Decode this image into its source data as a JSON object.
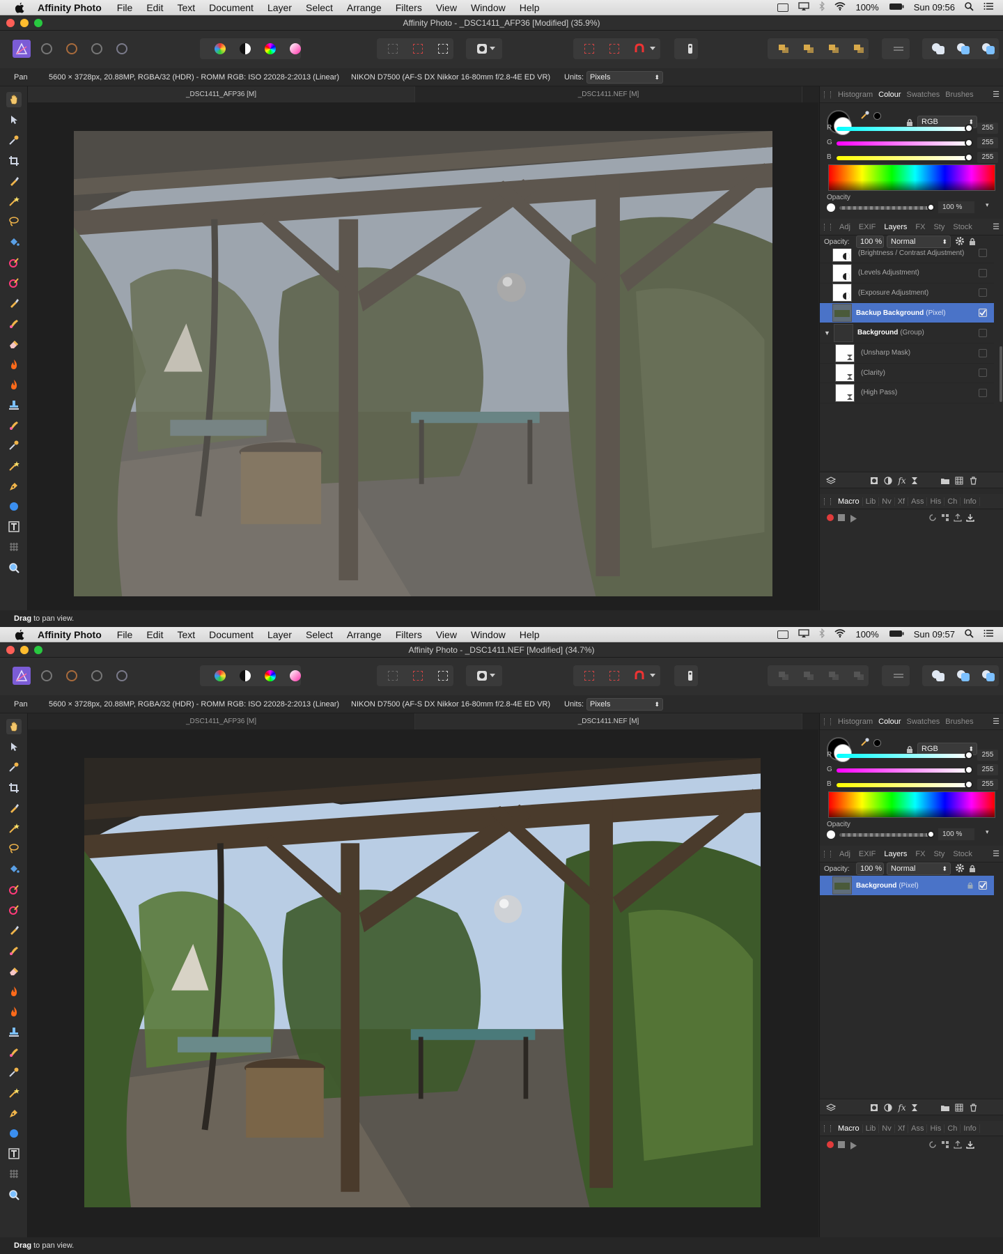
{
  "windows": [
    {
      "menubar": {
        "app_name": "Affinity Photo",
        "items": [
          "File",
          "Edit",
          "Text",
          "Document",
          "Layer",
          "Select",
          "Arrange",
          "Filters",
          "View",
          "Window",
          "Help"
        ],
        "battery": "100%",
        "clock": "Sun 09:56"
      },
      "title": "Affinity Photo - _DSC1411_AFP36 [Modified] (35.9%)",
      "context_bar": {
        "tool": "Pan",
        "doc_info": "5600 × 3728px, 20.88MP, RGBA/32 (HDR) - ROMM RGB: ISO 22028-2:2013 (Linear)",
        "camera": "NIKON D7500 (AF-S DX Nikkor 16-80mm f/2.8-4E ED VR)",
        "units_label": "Units:",
        "units_value": "Pixels"
      },
      "doc_tabs": [
        "_DSC1411_AFP36 [M]",
        "_DSC1411.NEF [M]"
      ],
      "active_tab": 0,
      "status": {
        "bold": "Drag",
        "text": " to pan view."
      },
      "colour_panel": {
        "tabs": [
          "Histogram",
          "Colour",
          "Swatches",
          "Brushes"
        ],
        "active": "Colour",
        "model": "RGB",
        "sliders": [
          {
            "label": "R",
            "value": "255"
          },
          {
            "label": "G",
            "value": "255"
          },
          {
            "label": "B",
            "value": "255"
          }
        ],
        "opacity_label": "Opacity",
        "opacity_value": "100 %"
      },
      "layers_panel": {
        "tabs": [
          "Adj",
          "EXIF",
          "Layers",
          "FX",
          "Sty",
          "Stock"
        ],
        "active": "Layers",
        "opacity_label": "Opacity:",
        "opacity_value": "100 %",
        "blend_mode": "Normal",
        "layers": [
          {
            "name": "",
            "type": "(Brightness / Contrast Adjustment)",
            "selected": false,
            "thumb": "adj",
            "indent": 0
          },
          {
            "name": "",
            "type": "(Levels Adjustment)",
            "selected": false,
            "thumb": "adj",
            "indent": 0
          },
          {
            "name": "",
            "type": "(Exposure Adjustment)",
            "selected": false,
            "thumb": "adj",
            "indent": 0
          },
          {
            "name": "Backup Background",
            "type": "(Pixel)",
            "selected": true,
            "thumb": "photo",
            "indent": 0,
            "checked": true
          },
          {
            "name": "Background",
            "type": "(Group)",
            "selected": false,
            "thumb": "group",
            "indent": 0,
            "expanded": true
          },
          {
            "name": "",
            "type": "(Unsharp Mask)",
            "selected": false,
            "thumb": "filter",
            "indent": 1
          },
          {
            "name": "",
            "type": "(Clarity)",
            "selected": false,
            "thumb": "filter",
            "indent": 1
          },
          {
            "name": "",
            "type": "(High Pass)",
            "selected": false,
            "thumb": "filter",
            "indent": 1
          }
        ]
      },
      "macro_panel": {
        "tabs": [
          "Macro",
          "Lib",
          "Nv",
          "Xf",
          "Ass",
          "His",
          "Ch",
          "Info"
        ],
        "active": "Macro"
      },
      "photo_variant": "flat"
    },
    {
      "menubar": {
        "app_name": "Affinity Photo",
        "items": [
          "File",
          "Edit",
          "Text",
          "Document",
          "Layer",
          "Select",
          "Arrange",
          "Filters",
          "View",
          "Window",
          "Help"
        ],
        "battery": "100%",
        "clock": "Sun 09:57"
      },
      "title": "Affinity Photo - _DSC1411.NEF [Modified] (34.7%)",
      "context_bar": {
        "tool": "Pan",
        "doc_info": "5600 × 3728px, 20.88MP, RGBA/32 (HDR) - ROMM RGB: ISO 22028-2:2013 (Linear)",
        "camera": "NIKON D7500 (AF-S DX Nikkor 16-80mm f/2.8-4E ED VR)",
        "units_label": "Units:",
        "units_value": "Pixels"
      },
      "doc_tabs": [
        "_DSC1411_AFP36 [M]",
        "_DSC1411.NEF [M]"
      ],
      "active_tab": 1,
      "status": {
        "bold": "Drag",
        "text": " to pan view."
      },
      "colour_panel": {
        "tabs": [
          "Histogram",
          "Colour",
          "Swatches",
          "Brushes"
        ],
        "active": "Colour",
        "model": "RGB",
        "sliders": [
          {
            "label": "R",
            "value": "255"
          },
          {
            "label": "G",
            "value": "255"
          },
          {
            "label": "B",
            "value": "255"
          }
        ],
        "opacity_label": "Opacity",
        "opacity_value": "100 %"
      },
      "layers_panel": {
        "tabs": [
          "Adj",
          "EXIF",
          "Layers",
          "FX",
          "Sty",
          "Stock"
        ],
        "active": "Layers",
        "opacity_label": "Opacity:",
        "opacity_value": "100 %",
        "blend_mode": "Normal",
        "layers": [
          {
            "name": "Background",
            "type": "(Pixel)",
            "selected": true,
            "thumb": "photo",
            "indent": 0,
            "checked": true,
            "locked": true
          }
        ]
      },
      "macro_panel": {
        "tabs": [
          "Macro",
          "Lib",
          "Nv",
          "Xf",
          "Ass",
          "His",
          "Ch",
          "Info"
        ],
        "active": "Macro"
      },
      "photo_variant": "contrast"
    }
  ],
  "colors": {
    "accent": "#4a73c8",
    "panel_bg": "#2a2a2a",
    "canvas_bg": "#1f1f1f"
  }
}
